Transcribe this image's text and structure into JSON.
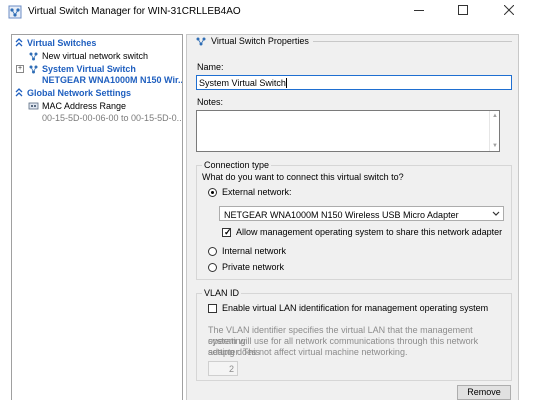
{
  "window": {
    "title": "Virtual Switch Manager for WIN-31CRLLEB4AO",
    "icon": "virtual-switch-manager-icon",
    "controls": {
      "minimize": "minimize-icon",
      "maximize": "maximize-icon",
      "close": "close-icon"
    }
  },
  "sidebar": {
    "virtual_switches_header": "Virtual Switches",
    "new_switch_label": "New virtual network switch",
    "selected_switch": {
      "name": "System Virtual Switch",
      "adapter": "NETGEAR WNA1000M N150 Wir..."
    },
    "global_header": "Global Network Settings",
    "mac_range": {
      "label": "MAC Address Range",
      "value": "00-15-5D-00-06-00 to 00-15-5D-0..."
    }
  },
  "properties": {
    "header": "Virtual Switch Properties",
    "name_label": "Name:",
    "name_value": "System Virtual Switch",
    "notes_label": "Notes:",
    "notes_value": "",
    "connection_type": {
      "legend": "Connection type",
      "question": "What do you want to connect this virtual switch to?",
      "external_label": "External network:",
      "adapter_selected": "NETGEAR WNA1000M N150 Wireless USB Micro Adapter",
      "allow_mgmt_label": "Allow management operating system to share this network adapter",
      "allow_mgmt_checked": true,
      "internal_label": "Internal network",
      "private_label": "Private network",
      "selected": "external"
    },
    "vlan": {
      "legend": "VLAN ID",
      "enable_label": "Enable virtual LAN identification for management operating system",
      "enable_checked": false,
      "description_lines": [
        "The VLAN identifier specifies the virtual LAN that the management operating",
        "system will use for all network communications through this network adapter. This",
        "setting does not affect virtual machine networking."
      ],
      "id_value": "2"
    },
    "remove_label": "Remove"
  },
  "colors": {
    "accent": "#1f5fbf",
    "pane_bg": "#f0f0f0",
    "disabled_text": "#8c8c8c"
  }
}
